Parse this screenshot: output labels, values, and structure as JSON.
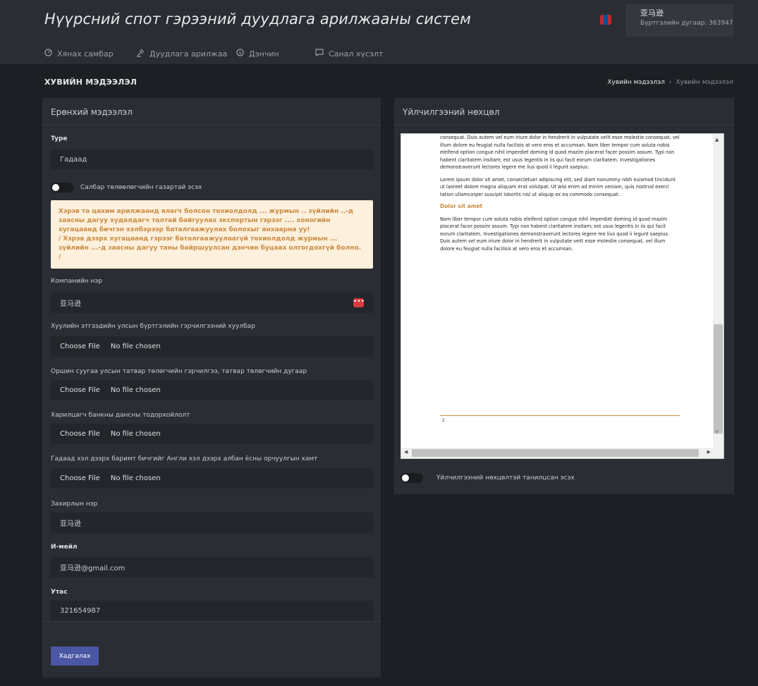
{
  "header": {
    "title": "Нүүрсний спот гэрээний дуудлага арилжааны систем",
    "user_name": "亚马逊",
    "user_reg": "Бүртгэлийн дугаар: 363947"
  },
  "nav": {
    "items": [
      {
        "label": "Хянах самбар",
        "icon": "dashboard-icon"
      },
      {
        "label": "Дуудлага арилжаа",
        "icon": "auction-icon"
      },
      {
        "label": "Дэнчин",
        "icon": "coin-icon"
      },
      {
        "label": "Санал хүсэлт",
        "icon": "feedback-icon"
      }
    ]
  },
  "page": {
    "title": "ХУВИЙН МЭДЭЭЛЭЛ",
    "breadcrumb": {
      "current": "Хувийн мэдээлэл",
      "sep": "›",
      "last": "Хувийн мэдээлэл"
    }
  },
  "form": {
    "header": "Ерөнхий мэдээлэл",
    "type_label": "Type",
    "type_value": "Гадаад",
    "toggle_label": "Салбар төлөөлөгчийн газартай эсэх",
    "alert_line1": "Хэрэв та цахим арилжаанд ялагч болсон тохиолдолд ... журмын .. зүйлийн ..-д заасны дагуу худалдагч талтай байгуулах экспортын гэрээг .... хоногийн хугацаанд бичгэн хэлбэрээр баталгаажуулах болохыг анхаарна уу!",
    "alert_line2": "/ Хэрэв дээрх хугацаанд гэрээг баталгаажуулаагүй тохиолдолд журмын ... зүйлийн ...-д заасны дагуу таны байршуулсан дэнчин буцаах олгогдохгүй болно. /",
    "company_label": "Компанийн нэр",
    "company_value": "亚马逊",
    "company_btn": "•••",
    "file1_label": "Хуулийн этгээдийн улсын бүртгэлийн гэрчилгээний хуулбар",
    "file2_label": "Оршин суугаа улсын татвар төлөгчийн гэрчилгээ, татвар төлөгчийн дугаар",
    "file3_label": "Харилцагч банкны дансны тодорхойлолт",
    "file4_label": "Гадаад хэл дээрх баримт бичгийг Англи хэл дээрх албан ёсны орчуулгын хамт",
    "choose_file": "Choose File",
    "no_file": "No file chosen",
    "director_label": "Захирлын нэр",
    "director_value": "亚马逊",
    "email_label": "И-мейл",
    "email_value": "亚马逊@gmail.com",
    "phone_label": "Утас",
    "phone_value": "321654987",
    "save": "Хадгалах"
  },
  "terms": {
    "header": "Үйлчилгээний нөхцөл",
    "para1": "consequat. Duis autem vel eum iriure dolor in hendrerit in vulputate velit esse molestie consequat, vel illum dolore eu feugiat nulla facilisis at vero eros et accumsan. Nam liber tempor cum soluta nobis eleifend option congue nihil imperdiet doming id quod mazim placerat facer possim assum. Typi non habent claritatem insitam; est usus legentis in iis qui facit eorum claritatem. Investigationes demonstraverunt lectores legere me lius quod ii legunt saepius.",
    "para2": "Lorem ipsum dolor sit amet, consectetuer adipiscing elit, sed diam nonummy nibh euismod tincidunt ut laoreet dolore magna aliquam erat volutpat. Ut wisi enim ad minim veniam, quis nostrud exerci tation ullamcorper suscipit lobortis nisl ut aliquip ex ea commodo consequat.",
    "heading": "Dolor sit amet",
    "para3": "Nam liber tempor cum soluta nobis eleifend option congue nihil imperdiet doming id quod mazim placerat facer possim assum. Typi non habent claritatem insitam; est usus legentis in iis qui facit eorum claritatem. Investigationes demonstraverunt lectores legere me lius quod ii legunt saepius. Duis autem vel eum iriure dolor in hendrerit in vulputate velit esse molestie consequat, vel illum dolore eu feugiat nulla facilisis at vero eros et accumsan.",
    "page_no": "2",
    "agree_label": "Үйлчилгээний нөхцөлтэй танилцсан эсэх"
  }
}
